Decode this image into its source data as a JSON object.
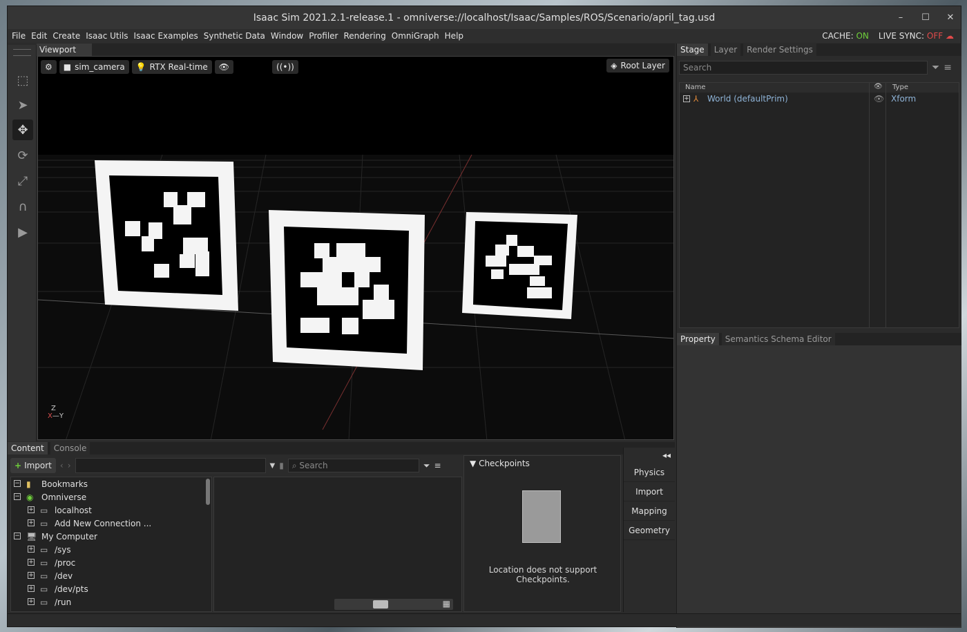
{
  "window": {
    "title": "Isaac Sim 2021.2.1-release.1 - omniverse://localhost/Isaac/Samples/ROS/Scenario/april_tag.usd"
  },
  "menu": [
    "File",
    "Edit",
    "Create",
    "Isaac Utils",
    "Isaac Examples",
    "Synthetic Data",
    "Window",
    "Profiler",
    "Rendering",
    "OmniGraph",
    "Help"
  ],
  "status": {
    "cache_label": "CACHE:",
    "cache_value": "ON",
    "live_label": "LIVE SYNC:",
    "live_value": "OFF"
  },
  "viewport": {
    "tab": "Viewport",
    "camera": "sim_camera",
    "renderer": "RTX Real-time",
    "root_layer": "Root Layer",
    "axis_z": "Z",
    "axis_x": "X",
    "axis_y": "Y"
  },
  "stage": {
    "tabs": [
      "Stage",
      "Layer",
      "Render Settings"
    ],
    "search_placeholder": "Search",
    "columns": {
      "name": "Name",
      "type": "Type"
    },
    "rows": [
      {
        "name": "World (defaultPrim)",
        "type": "Xform"
      }
    ]
  },
  "property": {
    "tabs": [
      "Property",
      "Semantics Schema Editor"
    ]
  },
  "content": {
    "tabs": [
      "Content",
      "Console"
    ],
    "import_label": "Import",
    "search_placeholder": "Search",
    "tree": [
      {
        "label": "Bookmarks",
        "level": 0,
        "expander": "−"
      },
      {
        "label": "Omniverse",
        "level": 0,
        "expander": "−"
      },
      {
        "label": "localhost",
        "level": 1,
        "expander": "+"
      },
      {
        "label": "Add New Connection ...",
        "level": 1,
        "expander": "+"
      },
      {
        "label": "My Computer",
        "level": 0,
        "expander": "−"
      },
      {
        "label": "/sys",
        "level": 1,
        "expander": "+"
      },
      {
        "label": "/proc",
        "level": 1,
        "expander": "+"
      },
      {
        "label": "/dev",
        "level": 1,
        "expander": "+"
      },
      {
        "label": "/dev/pts",
        "level": 1,
        "expander": "+"
      },
      {
        "label": "/run",
        "level": 1,
        "expander": "+"
      }
    ],
    "checkpoints_title": "Checkpoints",
    "checkpoints_message": "Location does not support Checkpoints."
  },
  "side_buttons": [
    "Physics",
    "Import",
    "Mapping",
    "Geometry"
  ]
}
